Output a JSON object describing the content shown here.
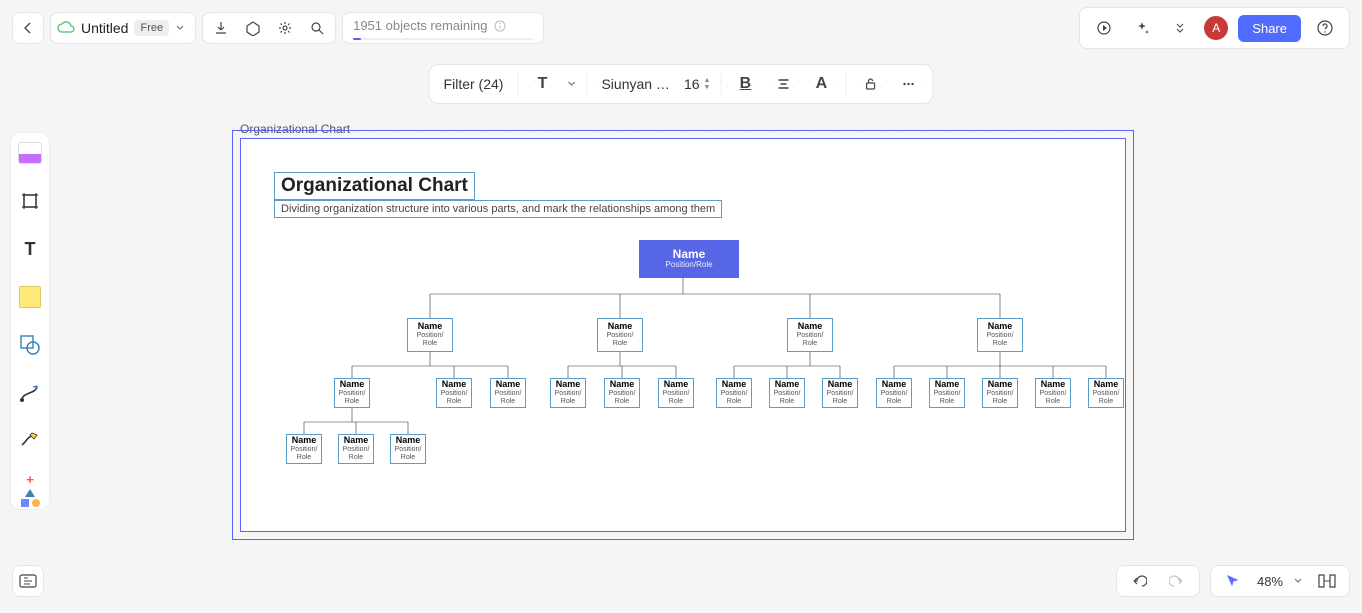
{
  "topbar": {
    "doc_name": "Untitled",
    "plan_badge": "Free",
    "status": "1951 objects remaining",
    "avatar_letter": "A",
    "share_label": "Share"
  },
  "second_toolbar": {
    "filter_label": "Filter (24)",
    "font_name": "Siunyan …",
    "font_size": "16"
  },
  "frame": {
    "label": "Organizational Chart",
    "title": "Organizational Chart",
    "subtitle": "Dividing organization structure into various parts, and mark the relationships among them"
  },
  "node_default": {
    "name": "Name",
    "role": "Position/Role",
    "role1": "Position/",
    "role2": "Role"
  },
  "zoom": {
    "label": "48%"
  }
}
